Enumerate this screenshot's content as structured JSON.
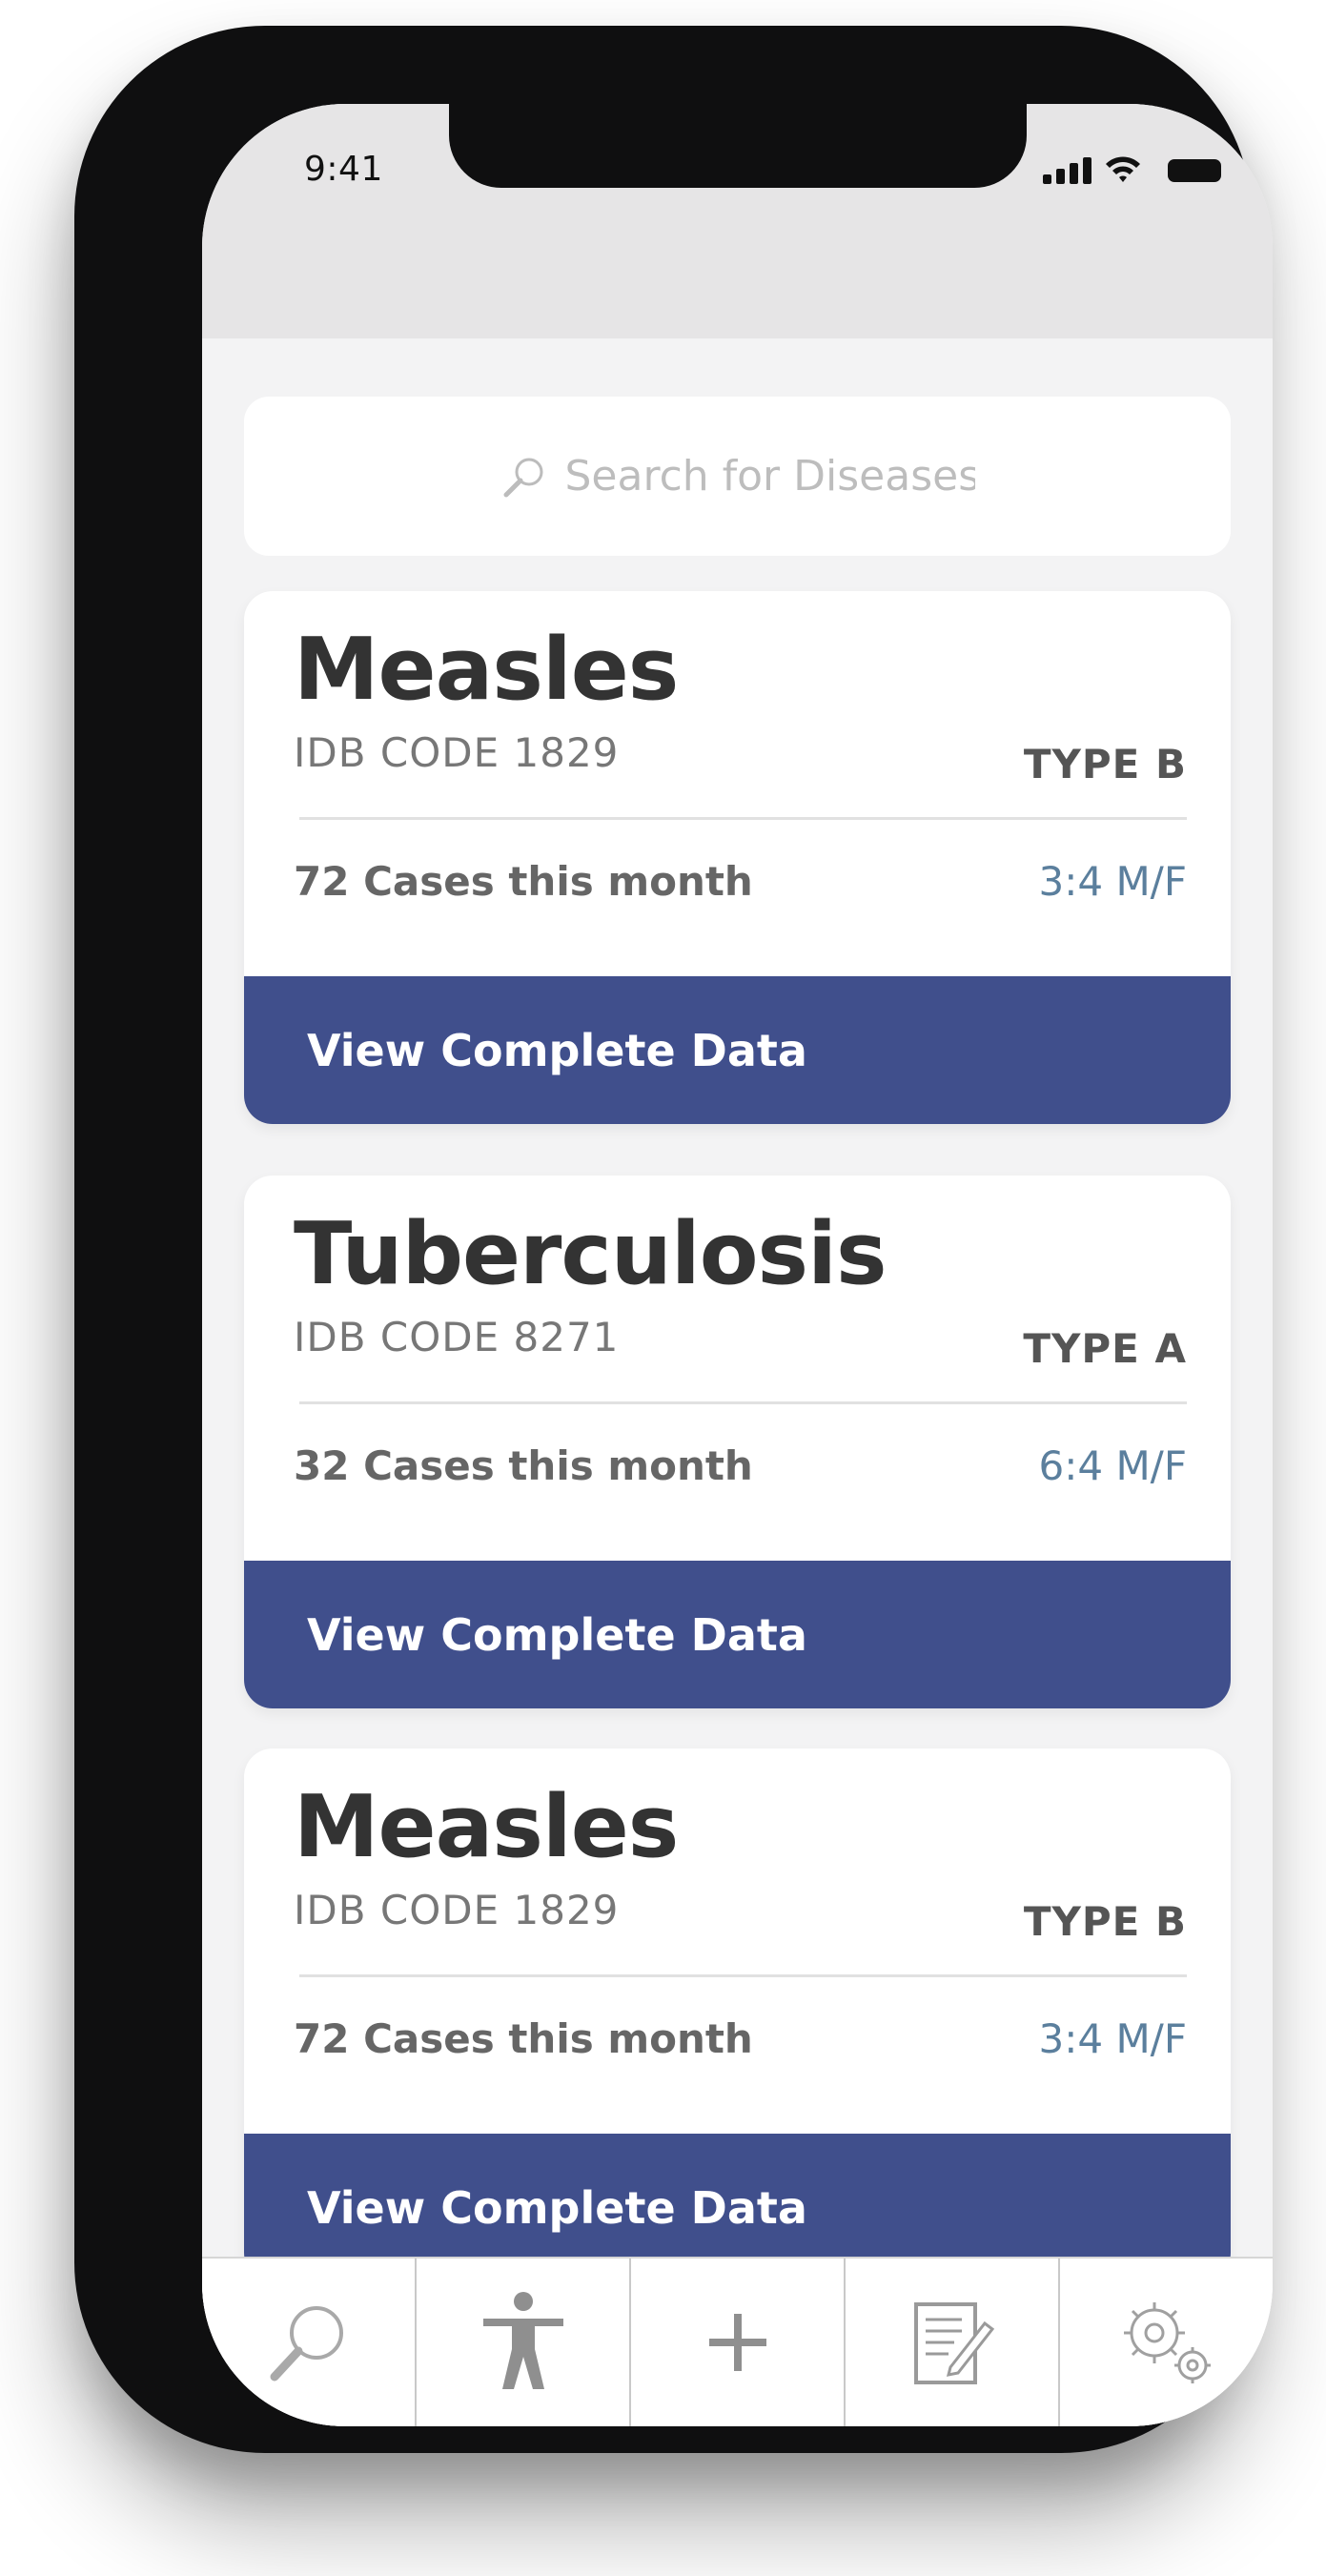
{
  "status_bar": {
    "time": "9:41"
  },
  "search": {
    "placeholder": "Search for Diseases",
    "icon": "search-icon"
  },
  "cards": [
    {
      "name": "Measles",
      "code": "IDB CODE 1829",
      "type": "TYPE B",
      "cases": "72 Cases this month",
      "ratio": "3:4 M/F",
      "button_label": "View Complete Data"
    },
    {
      "name": "Tuberculosis",
      "code": "IDB CODE 8271",
      "type": "TYPE A",
      "cases": "32 Cases this month",
      "ratio": "6:4 M/F",
      "button_label": "View Complete Data"
    },
    {
      "name": "Measles",
      "code": "IDB CODE 1829",
      "type": "TYPE B",
      "cases": "72 Cases this month",
      "ratio": "3:4 M/F",
      "button_label": "View Complete Data"
    }
  ],
  "tabbar": {
    "tabs": [
      {
        "icon": "search-icon"
      },
      {
        "icon": "person-icon"
      },
      {
        "icon": "plus-icon"
      },
      {
        "icon": "document-edit-icon"
      },
      {
        "icon": "gears-icon"
      }
    ]
  },
  "colors": {
    "accent": "#404f8c",
    "ratio": "#5b7f9d",
    "header_bg": "#e6e5e6",
    "screen_bg": "#f3f3f4"
  }
}
